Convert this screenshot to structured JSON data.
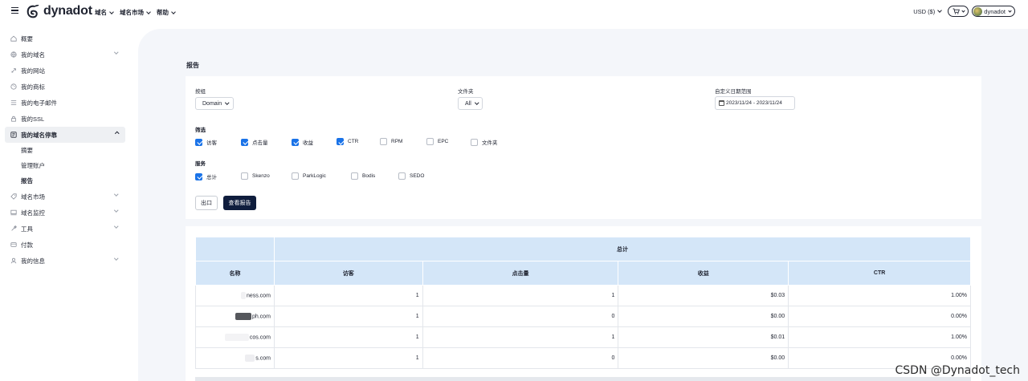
{
  "brand": {
    "name": "dynadot"
  },
  "topnav": {
    "domains": "域名",
    "market": "域名市场",
    "help": "帮助"
  },
  "topright": {
    "currency": "USD ($)",
    "username": "dynadot"
  },
  "sidebar": {
    "items": [
      {
        "label": "概要",
        "icon": "home-icon"
      },
      {
        "label": "我的域名",
        "icon": "globe-icon"
      },
      {
        "label": "我的网站",
        "icon": "rocket-icon"
      },
      {
        "label": "我的商标",
        "icon": "palette-icon"
      },
      {
        "label": "我的电子邮件",
        "icon": "mail-icon"
      },
      {
        "label": "我的SSL",
        "icon": "lock-icon"
      },
      {
        "label": "我的域名停靠",
        "icon": "parking-icon"
      },
      {
        "label": "域名市场",
        "icon": "tag-icon"
      },
      {
        "label": "域名监控",
        "icon": "monitor-icon"
      },
      {
        "label": "工具",
        "icon": "wrench-icon"
      },
      {
        "label": "付款",
        "icon": "card-icon"
      },
      {
        "label": "我的信息",
        "icon": "user-icon"
      }
    ],
    "parking_sub": [
      "摘要",
      "管理账户",
      "报告"
    ]
  },
  "page": {
    "title": "报告"
  },
  "filters": {
    "group_label": "按组",
    "group_value": "Domain",
    "folder_label": "文件夹",
    "folder_value": "All",
    "date_label": "自定义日期范围",
    "date_value": "2023/11/24 - 2023/11/24",
    "filter_label": "筛选",
    "metrics": [
      {
        "label": "访客",
        "checked": true
      },
      {
        "label": "点击量",
        "checked": true
      },
      {
        "label": "收益",
        "checked": true
      },
      {
        "label": "CTR",
        "checked": true
      },
      {
        "label": "RPM",
        "checked": false
      },
      {
        "label": "EPC",
        "checked": false
      },
      {
        "label": "文件夹",
        "checked": false
      }
    ],
    "service_label": "服务",
    "services": [
      {
        "label": "总计",
        "checked": true
      },
      {
        "label": "Skenzo",
        "checked": false
      },
      {
        "label": "ParkLogic",
        "checked": false
      },
      {
        "label": "Bodis",
        "checked": false
      },
      {
        "label": "SEDO",
        "checked": false
      }
    ],
    "export_label": "出口",
    "view_label": "查看报告"
  },
  "table": {
    "group_header": "总计",
    "columns": [
      "名称",
      "访客",
      "点击量",
      "收益",
      "CTR"
    ],
    "rows": [
      {
        "name": "ness.com",
        "visitors": "1",
        "clicks": "1",
        "revenue": "$0.03",
        "ctr": "1.00%"
      },
      {
        "name": "ph.com",
        "visitors": "1",
        "clicks": "0",
        "revenue": "$0.00",
        "ctr": "0.00%"
      },
      {
        "name": "cos.com",
        "visitors": "1",
        "clicks": "1",
        "revenue": "$0.01",
        "ctr": "1.00%"
      },
      {
        "name": "s.com",
        "visitors": "1",
        "clicks": "0",
        "revenue": "$0.00",
        "ctr": "0.00%"
      }
    ]
  },
  "watermark": "CSDN @Dynadot_tech",
  "colors": {
    "accent": "#1a73e8",
    "primary_button": "#0f1d3d",
    "table_header": "#d4e6f8"
  }
}
